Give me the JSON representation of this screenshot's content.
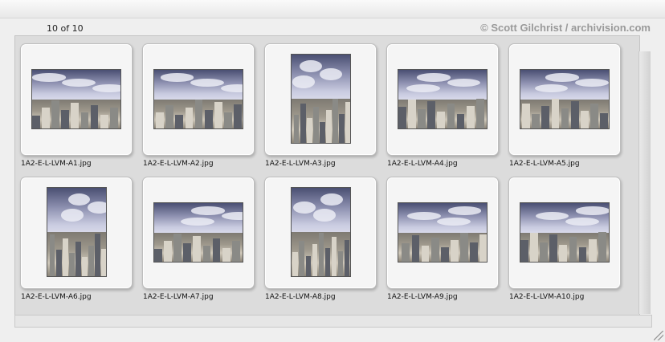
{
  "header": {
    "count_label": "10 of 10",
    "copyright": "© Scott Gilchrist / archivision.com"
  },
  "thumbnails": [
    {
      "filename": "1A2-E-L-LVM-A1.jpg",
      "orientation": "landscape"
    },
    {
      "filename": "1A2-E-L-LVM-A2.jpg",
      "orientation": "landscape"
    },
    {
      "filename": "1A2-E-L-LVM-A3.jpg",
      "orientation": "portrait"
    },
    {
      "filename": "1A2-E-L-LVM-A4.jpg",
      "orientation": "landscape"
    },
    {
      "filename": "1A2-E-L-LVM-A5.jpg",
      "orientation": "landscape"
    },
    {
      "filename": "1A2-E-L-LVM-A6.jpg",
      "orientation": "portrait"
    },
    {
      "filename": "1A2-E-L-LVM-A7.jpg",
      "orientation": "landscape"
    },
    {
      "filename": "1A2-E-L-LVM-A8.jpg",
      "orientation": "portrait"
    },
    {
      "filename": "1A2-E-L-LVM-A9.jpg",
      "orientation": "landscape"
    },
    {
      "filename": "1A2-E-L-LVM-A10.jpg",
      "orientation": "landscape"
    }
  ],
  "colors": {
    "frame_bg": "#dcdcdc",
    "slide_bg": "#f5f5f5",
    "copyright_text": "#9a9a9a"
  }
}
